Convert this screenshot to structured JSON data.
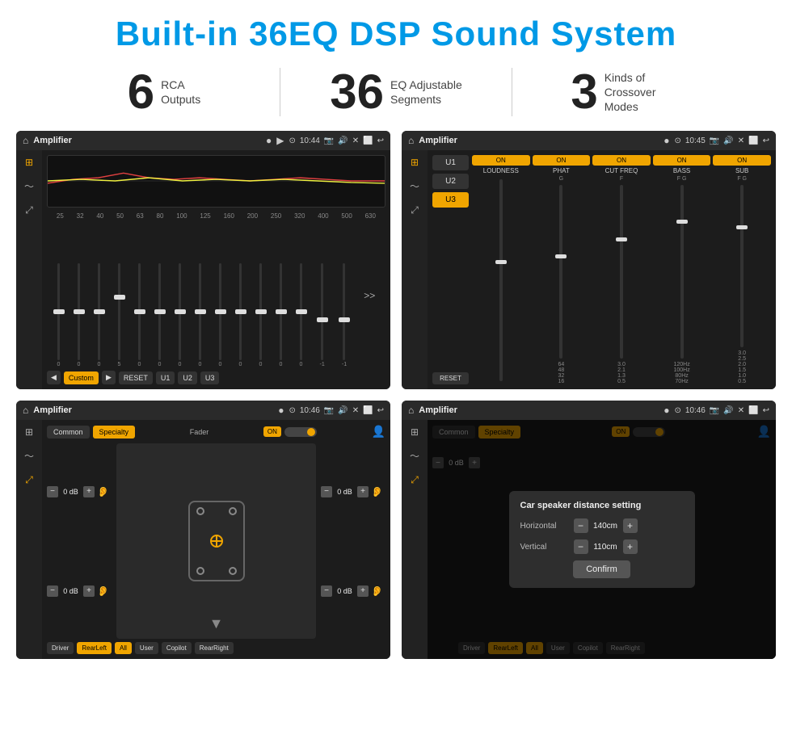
{
  "header": {
    "title": "Built-in 36EQ DSP Sound System"
  },
  "stats": [
    {
      "number": "6",
      "text": "RCA\nOutputs"
    },
    {
      "number": "36",
      "text": "EQ Adjustable\nSegments"
    },
    {
      "number": "3",
      "text": "Kinds of\nCrossover Modes"
    }
  ],
  "screen1": {
    "title": "Amplifier",
    "time": "10:44",
    "eq_freqs": [
      "25",
      "32",
      "40",
      "50",
      "63",
      "80",
      "100",
      "125",
      "160",
      "200",
      "250",
      "320",
      "400",
      "500",
      "630"
    ],
    "eq_values": [
      "0",
      "0",
      "0",
      "5",
      "0",
      "0",
      "0",
      "0",
      "0",
      "0",
      "0",
      "0",
      "0",
      "-1",
      "-1"
    ],
    "buttons": [
      "Custom",
      "RESET",
      "U1",
      "U2",
      "U3"
    ]
  },
  "screen2": {
    "title": "Amplifier",
    "time": "10:45",
    "u_buttons": [
      "U1",
      "U2",
      "U3"
    ],
    "channels": [
      "LOUDNESS",
      "PHAT",
      "CUT FREQ",
      "BASS",
      "SUB"
    ],
    "on_label": "ON",
    "reset_label": "RESET"
  },
  "screen3": {
    "title": "Amplifier",
    "time": "10:46",
    "tabs": [
      "Common",
      "Specialty"
    ],
    "fader_label": "Fader",
    "on_label": "ON",
    "vol_rows": [
      {
        "value": "0 dB"
      },
      {
        "value": "0 dB"
      },
      {
        "value": "0 dB"
      },
      {
        "value": "0 dB"
      }
    ],
    "bottom_buttons": [
      "Driver",
      "RearLeft",
      "All",
      "User",
      "Copilot",
      "RearRight"
    ]
  },
  "screen4": {
    "title": "Amplifier",
    "time": "10:46",
    "tabs": [
      "Common",
      "Specialty"
    ],
    "on_label": "ON",
    "dialog": {
      "title": "Car speaker distance setting",
      "horizontal_label": "Horizontal",
      "horizontal_value": "140cm",
      "vertical_label": "Vertical",
      "vertical_value": "110cm",
      "confirm_label": "Confirm"
    },
    "vol_rows": [
      {
        "value": "0 dB"
      },
      {
        "value": "0 dB"
      }
    ],
    "bottom_buttons": [
      "Driver",
      "RearLeft",
      "All",
      "User",
      "Copilot",
      "RearRight"
    ]
  },
  "icons": {
    "home": "⌂",
    "menu": "☰",
    "dot": "●",
    "play": "▶",
    "back": "↩",
    "location": "📍",
    "camera": "📷",
    "volume": "🔊",
    "close": "✕",
    "screen": "⬜",
    "sliders": "≡",
    "wave": "〜",
    "arrows": "⤢",
    "next": "⟩⟩"
  }
}
